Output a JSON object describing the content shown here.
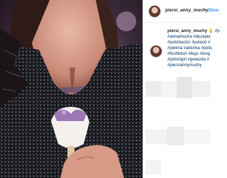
{
  "post": {
    "photo_alt": "photo",
    "user": "piersi_anny_muchy",
    "follow_dot": "•",
    "follow_label": "Obse"
  },
  "caption": {
    "user": "piersi_anny_muchy",
    "emoji": "💡",
    "first_tag": "#p",
    "lines": [
      "#annamucha #duzepie",
      "#polishactor #poland #",
      "#piekna #aktorka #polis",
      "#footfetish #legs #long",
      "#polishgirl #gwiazda #",
      "#piersiannymuchy"
    ]
  },
  "colors": {
    "link": "#003569",
    "follow": "#3897f0",
    "text": "#262626"
  }
}
